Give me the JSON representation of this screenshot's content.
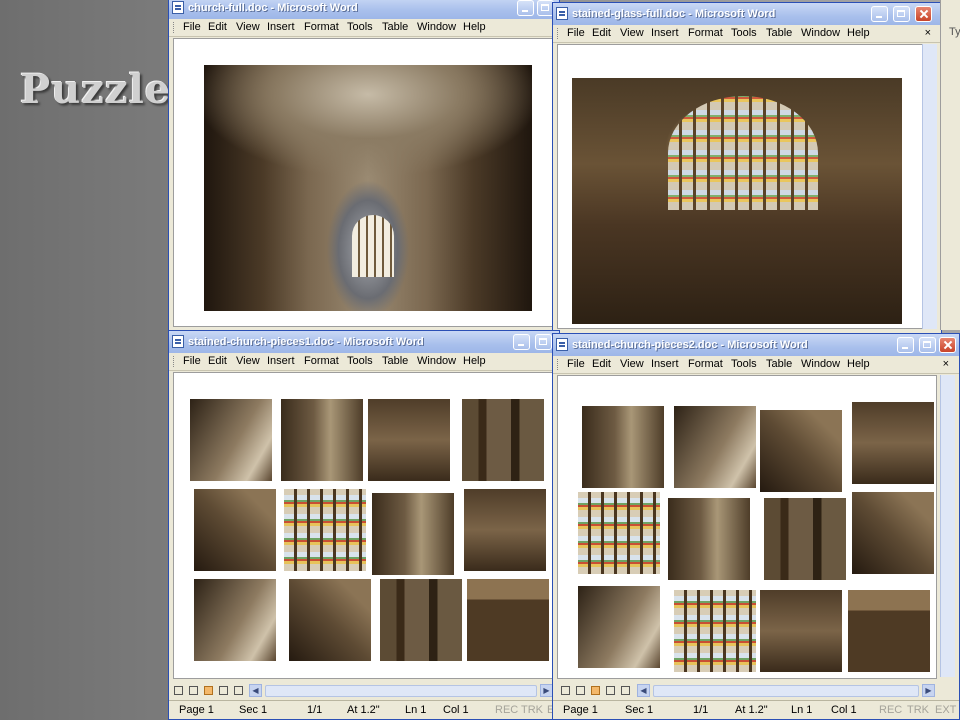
{
  "slide": {
    "title": "Puzzle"
  },
  "menu": [
    "File",
    "Edit",
    "View",
    "Insert",
    "Format",
    "Tools",
    "Table",
    "Window",
    "Help"
  ],
  "windows": {
    "w1": {
      "title": "church-full.doc - Microsoft Word"
    },
    "w2": {
      "title": "stained-glass-full.doc - Microsoft Word",
      "side_text": "Ty"
    },
    "w3": {
      "title": "stained-church-pieces1.doc - Microsoft Word"
    },
    "w4": {
      "title": "stained-church-pieces2.doc - Microsoft Word"
    }
  },
  "menu_close": "×",
  "status": {
    "page": "Page 1",
    "sec": "Sec 1",
    "pages": "1/1",
    "at": "At 1.2\"",
    "ln": "Ln 1",
    "col": "Col 1",
    "rec": "REC",
    "trk": "TRK",
    "ext": "EXT"
  },
  "colors": {
    "titlebar": "#a9c0ec",
    "chrome": "#ece9d8",
    "close": "#c8442a"
  }
}
